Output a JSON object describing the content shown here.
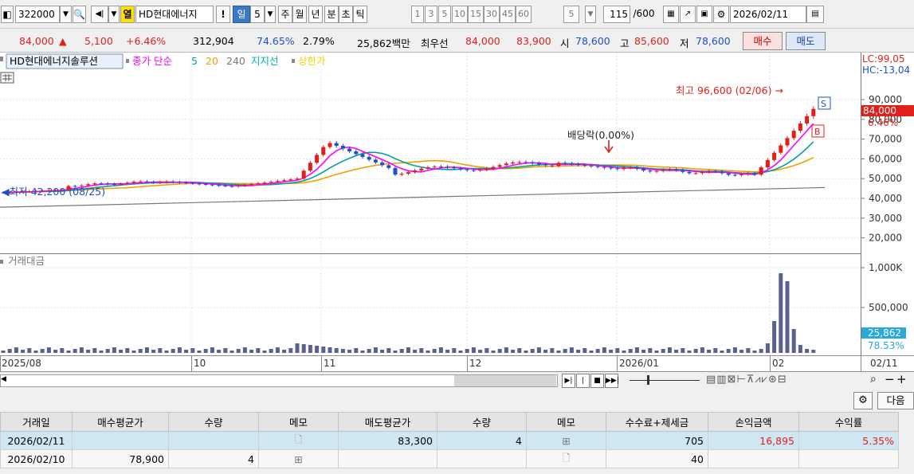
{
  "toolbar": {
    "code": "322000",
    "hl_label": "열",
    "name": "HD현대에너지",
    "bang": "!",
    "period_day": "일",
    "period_num": "5",
    "periods": [
      "주",
      "월",
      "년",
      "분",
      "초",
      "틱"
    ],
    "intervals": [
      "1",
      "3",
      "5",
      "10",
      "15",
      "30",
      "45",
      "60"
    ],
    "interval_sel": "5",
    "count": "115",
    "count_total": "/600",
    "date": "2026/02/11"
  },
  "quote": {
    "price": "84,000",
    "arrow": "▲",
    "change": "5,100",
    "pct": "+6.46%",
    "volume": "312,904",
    "vol_ratio": "74.65%",
    "turnover": "2.79%",
    "amount": "25,862백만",
    "best_label": "최우선",
    "ask": "84,000",
    "bid": "83,900",
    "open_label": "시",
    "open": "78,600",
    "high_label": "고",
    "high": "85,600",
    "low_label": "저",
    "low": "78,600",
    "buy_btn": "매수",
    "sell_btn": "매도"
  },
  "legend": {
    "name": "HD현대에너지솔루션",
    "close": "종가 단순",
    "ma5": "5",
    "ma20": "20",
    "ma240": "240",
    "support": "지지선",
    "limit": "상한가",
    "volume_title": "거래대금"
  },
  "annotations": {
    "lc": "LC:99,05",
    "hc": "HC:-13,04",
    "high_note": "최고 96,600 (02/06) →",
    "dividend": "배당락(0.00%)",
    "low_note": "◀최저 42,200 (08/25)",
    "s_mark": "S",
    "b_mark": "B"
  },
  "price_axis": [
    "90,000",
    "80,000",
    "70,000",
    "60,000",
    "50,000",
    "40,000",
    "30,000",
    "20,000"
  ],
  "price_tag": {
    "value": "84,000",
    "pct": "6.46%"
  },
  "volume_axis": [
    "1,000K",
    "500,000"
  ],
  "volume_tag": {
    "value": "25,862",
    "pct": "78.53%"
  },
  "x_labels": [
    "2025/08",
    "10",
    "11",
    "12",
    "2026/01",
    "02",
    "02/11"
  ],
  "table_controls": {
    "next": "다음"
  },
  "table": {
    "headers": [
      "거래일",
      "매수평균가",
      "수량",
      "메모",
      "매도평균가",
      "수량",
      "메모",
      "수수료+제세금",
      "손익금액",
      "수익률"
    ],
    "rows": [
      [
        "2026/02/11",
        "",
        "",
        "",
        "83,300",
        "4",
        "",
        "705",
        "16,895",
        "5.35%"
      ],
      [
        "2026/02/10",
        "78,900",
        "4",
        "",
        "",
        "",
        "",
        "40",
        "",
        ""
      ]
    ]
  },
  "colors": {
    "up": "#e0211b",
    "down": "#1c52c9",
    "ma5": "#ff00ff",
    "ma20": "#00a0a0",
    "ma60": "#f0a000",
    "ma240": "#777777"
  }
}
